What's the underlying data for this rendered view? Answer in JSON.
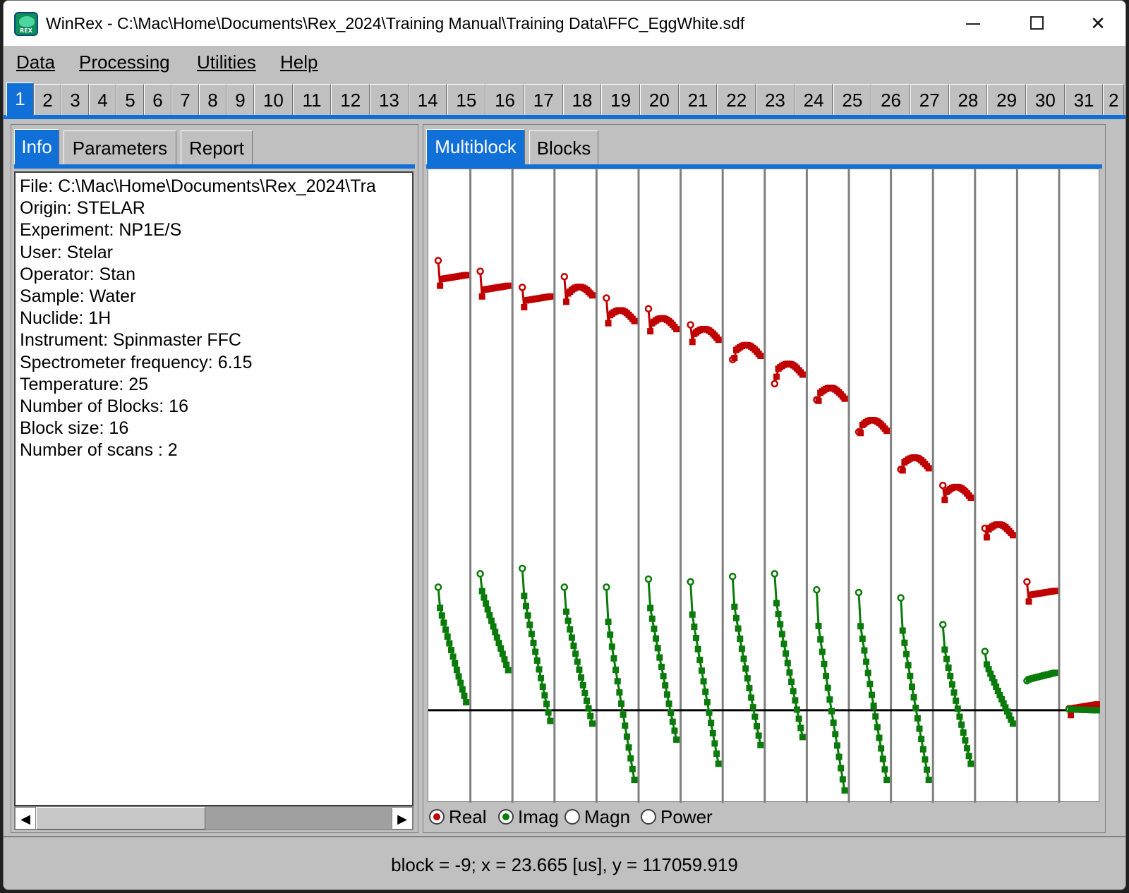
{
  "window": {
    "title": "WinRex - C:\\Mac\\Home\\Documents\\Rex_2024\\Training Manual\\Training Data\\FFC_EggWhite.sdf",
    "app_icon_text": "REX"
  },
  "menu": [
    "Data",
    "Processing",
    "Utilities",
    "Help"
  ],
  "block_tabs": [
    "1",
    "2",
    "3",
    "4",
    "5",
    "6",
    "7",
    "8",
    "9",
    "10",
    "11",
    "12",
    "13",
    "14",
    "15",
    "16",
    "17",
    "18",
    "19",
    "20",
    "21",
    "22",
    "23",
    "24",
    "25",
    "26",
    "27",
    "28",
    "29",
    "30",
    "31",
    "2"
  ],
  "active_block_tab": "1",
  "left_tabs": [
    "Info",
    "Parameters",
    "Report"
  ],
  "right_tabs": [
    "Multiblock",
    "Blocks"
  ],
  "info": {
    "lines": [
      "File: C:\\Mac\\Home\\Documents\\Rex_2024\\Tra",
      "Origin: STELAR",
      "Experiment: NP1E/S",
      "User: Stelar",
      "Operator: Stan",
      "Sample: Water",
      "Nuclide: 1H",
      "Instrument: Spinmaster FFC",
      "Spectrometer frequency: 6.15",
      "Temperature: 25",
      "Number of Blocks: 16",
      "Block size: 16",
      "Number of scans : 2"
    ]
  },
  "legend": [
    {
      "label": "Real",
      "selected": true,
      "color": "#c00000"
    },
    {
      "label": "Imag",
      "selected": true,
      "color": "#008000"
    },
    {
      "label": "Magn",
      "selected": false,
      "color": "#000000"
    },
    {
      "label": "Power",
      "selected": false,
      "color": "#000000"
    }
  ],
  "status": "block = -9; x = 23.665 [us], y = 117059.919",
  "colors": {
    "real": "#c00000",
    "imag": "#0a7a0a",
    "accent": "#1070d8",
    "divider": "#808080"
  },
  "chart_data": {
    "type": "line",
    "blocks": 16,
    "points_per_block": 16,
    "ylim": [
      -12,
      100
    ],
    "baseline_y": 0,
    "series": [
      {
        "name": "Real",
        "blocks": [
          {
            "start": 84,
            "level": 80.5
          },
          {
            "start": 82,
            "level": 78.5
          },
          {
            "start": 79,
            "level": 76.5
          },
          {
            "start": 81,
            "level": 77.5
          },
          {
            "start": 77,
            "level": 73.5
          },
          {
            "start": 75,
            "level": 72
          },
          {
            "start": 72,
            "level": 70
          },
          {
            "start": 65.5,
            "level": 67
          },
          {
            "start": 61,
            "level": 63.5
          },
          {
            "start": 58,
            "level": 59
          },
          {
            "start": 52,
            "level": 53
          },
          {
            "start": 45,
            "level": 46
          },
          {
            "start": 42,
            "level": 40.5
          },
          {
            "start": 34,
            "level": 33.5
          },
          {
            "start": 24,
            "level": 21.5
          },
          {
            "start": 0.3,
            "level": 0.3
          }
        ]
      },
      {
        "name": "Imag",
        "blocks": [
          {
            "start": 23,
            "end": 1.5
          },
          {
            "start": 25.5,
            "end": 7.5
          },
          {
            "start": 26.5,
            "end": -2
          },
          {
            "start": 23,
            "end": -2.5
          },
          {
            "start": 23,
            "end": -13
          },
          {
            "start": 24.5,
            "end": -5.5
          },
          {
            "start": 24,
            "end": -10
          },
          {
            "start": 25,
            "end": -6.5
          },
          {
            "start": 25.5,
            "end": -5
          },
          {
            "start": 22.5,
            "end": -15
          },
          {
            "start": 22,
            "end": -13
          },
          {
            "start": 21,
            "end": -13
          },
          {
            "start": 16,
            "end": -10
          },
          {
            "start": 11,
            "end": -2.5
          },
          {
            "start": 5.5,
            "end": 7
          },
          {
            "start": 0.2,
            "end": 0
          }
        ]
      }
    ]
  }
}
